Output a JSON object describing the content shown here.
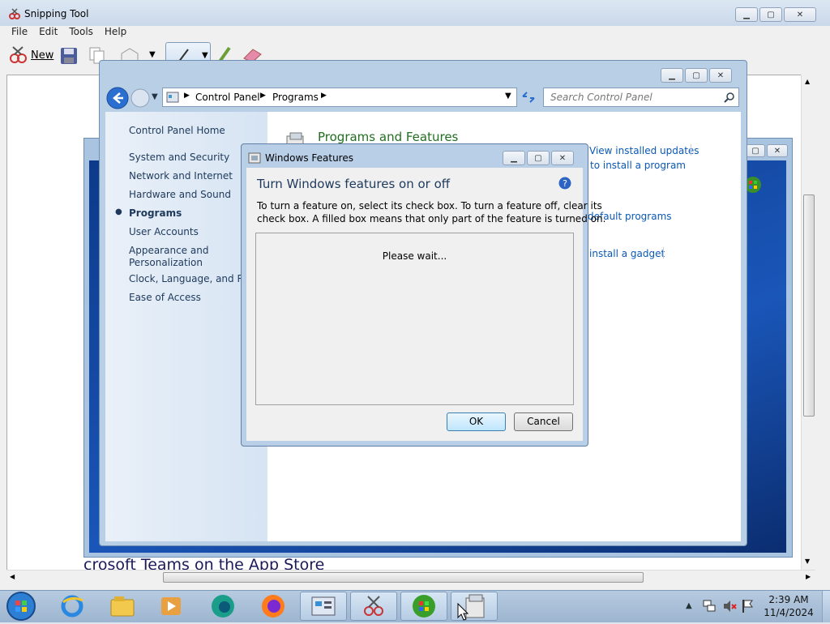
{
  "snipping_tool": {
    "title": "Snipping Tool",
    "menu": [
      "File",
      "Edit",
      "Tools",
      "Help"
    ],
    "new_label": "New"
  },
  "background_capture": {
    "caption_fragment": "crosoft Teams on the App Store"
  },
  "control_panel": {
    "breadcrumb": [
      "Control Panel",
      "Programs"
    ],
    "search_placeholder": "Search Control Panel",
    "nav": {
      "home": "Control Panel Home",
      "items": [
        "System and Security",
        "Network and Internet",
        "Hardware and Sound",
        "Programs",
        "User Accounts",
        "Appearance and",
        "Personalization",
        "Clock, Language, and Reg",
        "Ease of Access"
      ]
    },
    "section_title": "Programs and Features",
    "links": [
      "View installed updates",
      "to install a program",
      "default programs",
      "install a gadget"
    ]
  },
  "windows_features": {
    "title": "Windows Features",
    "heading": "Turn Windows features on or off",
    "description_line1": "To turn a feature on, select its check box. To turn a feature off, clear its",
    "description_line2": "check box. A filled box means that only part of the feature is turned on.",
    "status": "Please wait...",
    "ok": "OK",
    "cancel": "Cancel"
  },
  "taskbar": {
    "time": "2:39 AM",
    "date": "11/4/2024",
    "apps": [
      "internet-explorer",
      "file-explorer",
      "media-player",
      "edge",
      "firefox",
      "control-panel",
      "snipping-tool",
      "windows-media-center",
      "windows-features"
    ]
  },
  "colors": {
    "accent": "#1e5aa8",
    "link": "#0a58b5",
    "section_title": "#1f6f1f"
  }
}
